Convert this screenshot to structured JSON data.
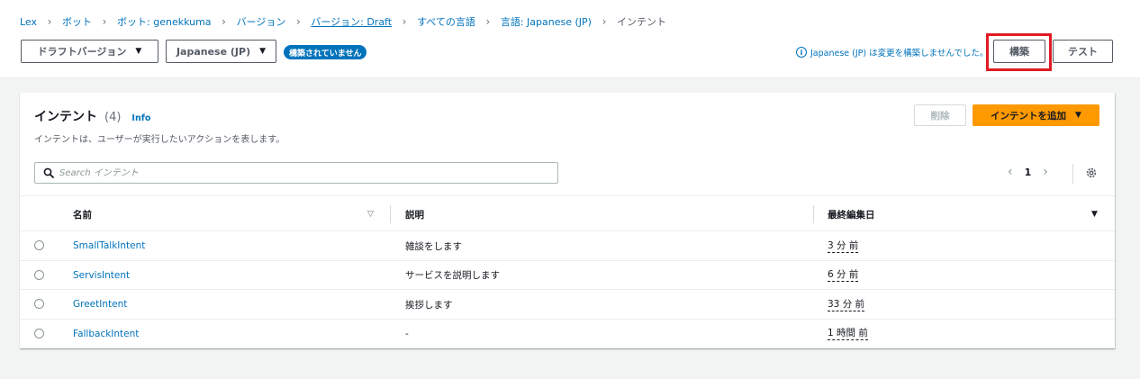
{
  "breadcrumb": {
    "items": [
      {
        "label": "Lex"
      },
      {
        "label": "ボット"
      },
      {
        "label": "ボット: genekkuma"
      },
      {
        "label": "バージョン"
      },
      {
        "label": "バージョン: Draft"
      },
      {
        "label": "すべての言語"
      },
      {
        "label": "言語: Japanese (JP)"
      },
      {
        "label": "インテント"
      }
    ]
  },
  "toolbar": {
    "version_select": "ドラフトバージョン",
    "language_select": "Japanese (JP)",
    "status_badge": "構築されていません",
    "notice": "Japanese (JP) は変更を構築しませんでした。",
    "notice_icon": "i",
    "build_button": "構築",
    "test_button": "テスト",
    "highlight_color": "#e01b24"
  },
  "panel": {
    "title": "インテント",
    "count": "(4)",
    "info_link": "Info",
    "description": "インテントは、ユーザーが実行したいアクションを表します。",
    "delete_button": "削除",
    "add_button": "インテントを追加",
    "search_placeholder": "Search インテント",
    "pagination": {
      "current_page": "1"
    },
    "accent_color": "#ff9900"
  },
  "table": {
    "columns": {
      "name": "名前",
      "description": "説明",
      "last_edited": "最終編集日"
    },
    "rows": [
      {
        "name": "SmallTalkIntent",
        "description": "雑談をします",
        "last_edited": "3 分 前"
      },
      {
        "name": "ServisIntent",
        "description": "サービスを説明します",
        "last_edited": "6 分 前"
      },
      {
        "name": "GreetIntent",
        "description": "挨拶します",
        "last_edited": "33 分 前"
      },
      {
        "name": "FallbackIntent",
        "description": "-",
        "last_edited": "1 時間 前"
      }
    ]
  }
}
